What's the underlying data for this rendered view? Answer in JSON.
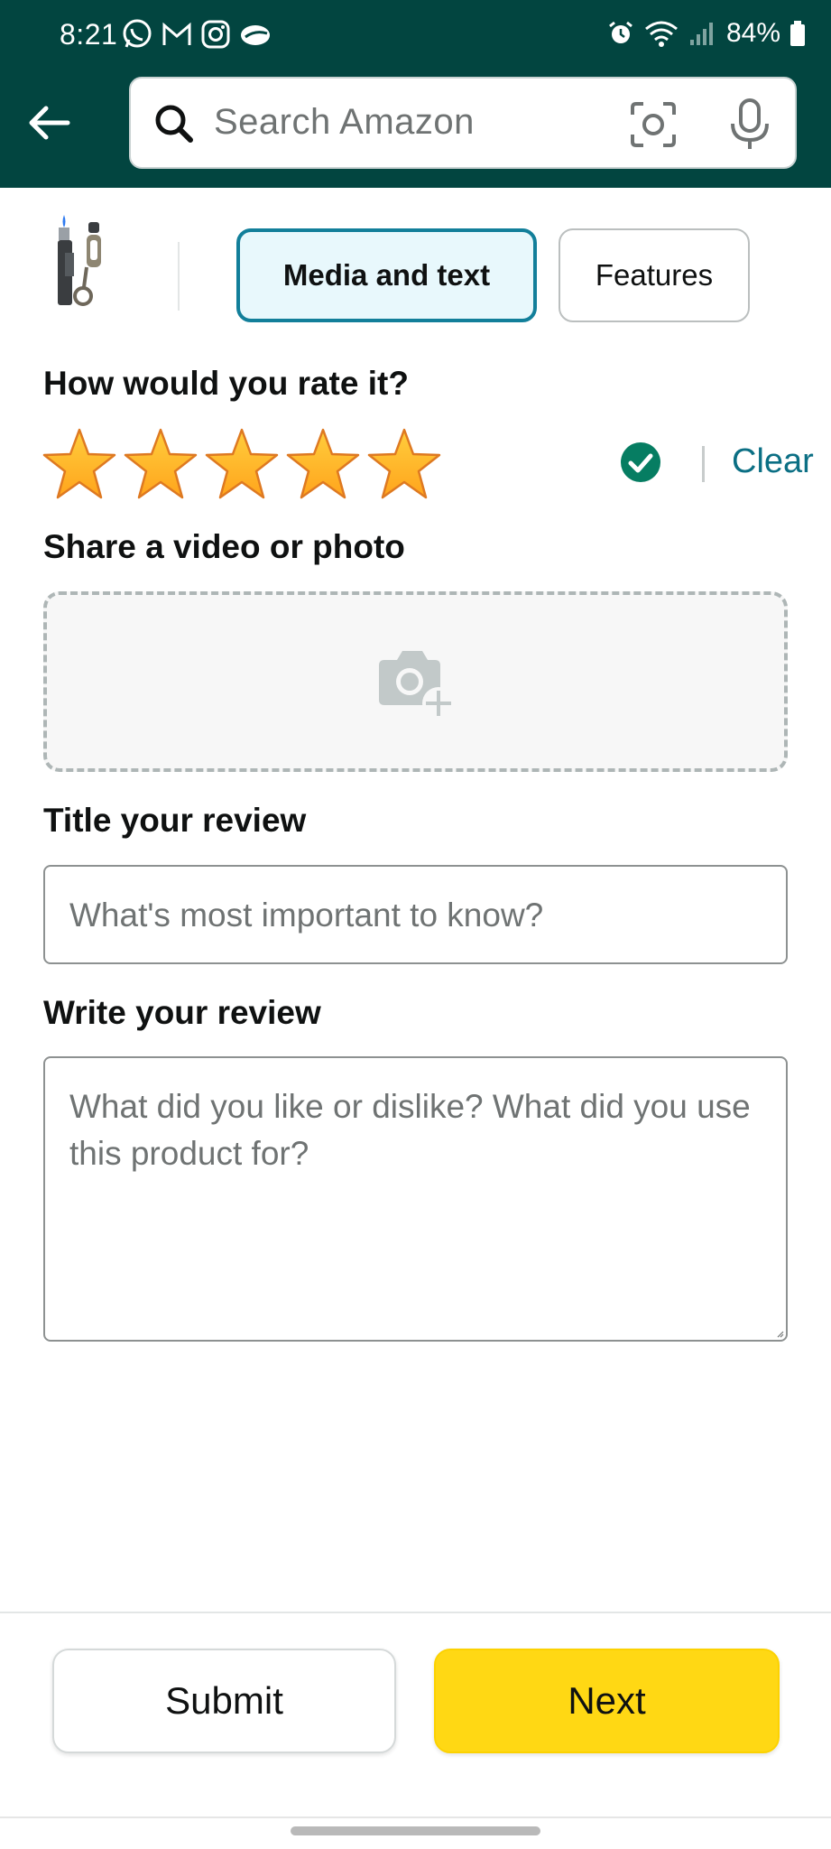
{
  "status_bar": {
    "time": "8:21",
    "battery": "84%",
    "left_icons": [
      "whatsapp-icon",
      "gmail-icon",
      "instagram-icon",
      "cloud-icon"
    ],
    "right_icons": [
      "alarm-icon",
      "wifi-icon",
      "signal-icon",
      "battery-icon"
    ]
  },
  "header": {
    "background_color": "#024540",
    "search_placeholder": "Search Amazon"
  },
  "tabs": [
    {
      "label": "Media and text",
      "selected": true
    },
    {
      "label": "Features",
      "selected": false
    }
  ],
  "rating": {
    "heading": "How would you rate it?",
    "stars_selected": 5,
    "stars_total": 5,
    "clear_label": "Clear",
    "star_color": "#ffa41c"
  },
  "media": {
    "heading": "Share a video or photo"
  },
  "title_field": {
    "heading": "Title your review",
    "placeholder": "What's most important to know?"
  },
  "review_field": {
    "heading": "Write your review",
    "placeholder": "What did you like or dislike? What did you use this product for?"
  },
  "footer": {
    "submit_label": "Submit",
    "next_label": "Next",
    "next_color": "#ffd814"
  }
}
